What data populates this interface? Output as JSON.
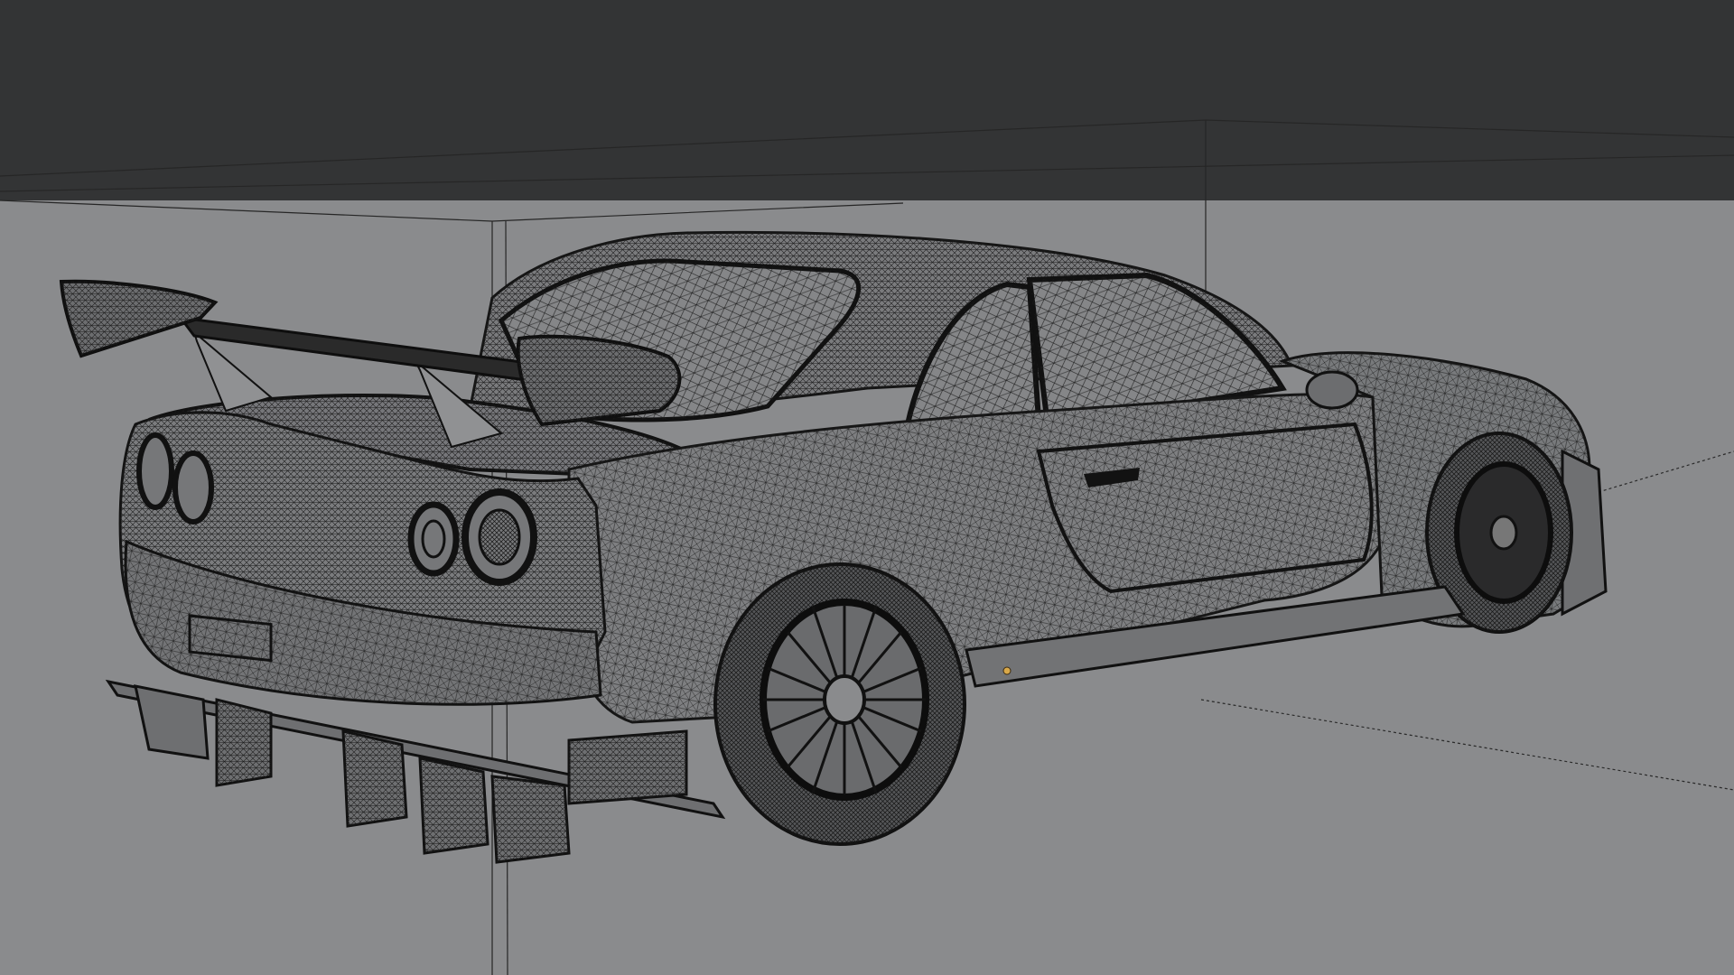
{
  "viewport": {
    "mode": "wireframe",
    "subject": "car-wireframe-model",
    "colors": {
      "floor": "#8a8b8d",
      "backdrop": "#333435",
      "wire": "#1c1c1c",
      "guide": "#2a2a2a",
      "pivot": "#d8a84a"
    }
  }
}
